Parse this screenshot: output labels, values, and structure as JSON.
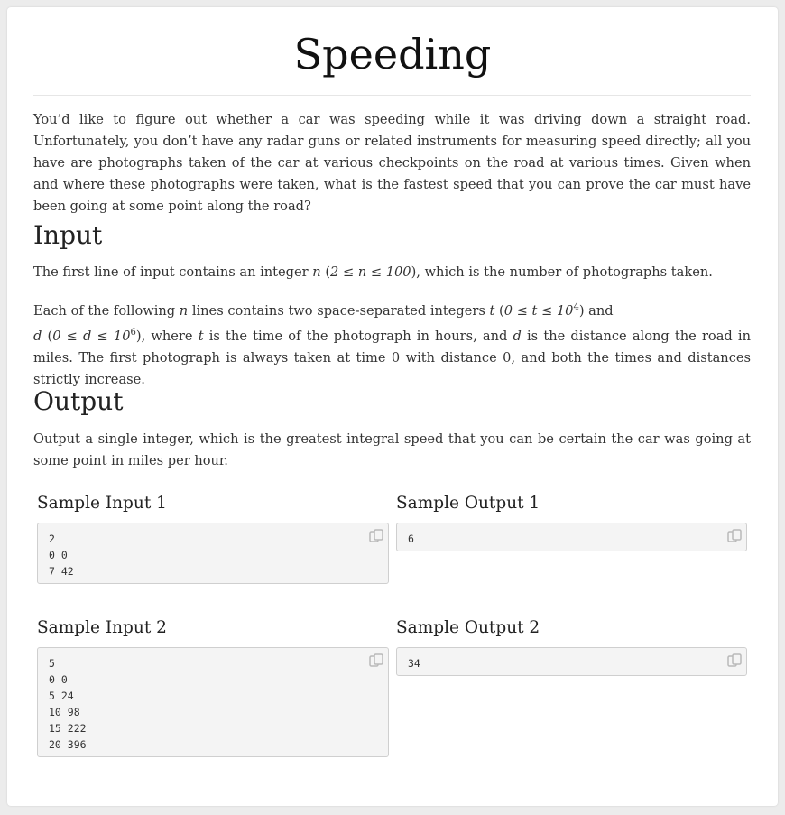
{
  "title": "Speeding",
  "intro": "You’d like to figure out whether a car was speeding while it was driving down a straight road. Unfortunately, you don’t have any radar guns or related instruments for measuring speed directly; all you have are photographs taken of the car at various checkpoints on the road at various times. Given when and where these photographs were taken, what is the fastest speed that you can prove the car must have been going at some point along the road?",
  "input": {
    "heading": "Input",
    "p1": {
      "a": "The first line of input contains an integer ",
      "var_n": "n",
      "b": " (",
      "math": "2 ≤ n ≤ 100",
      "c": "), which is the number of photographs taken."
    },
    "p2": {
      "a": "Each of the following ",
      "var_n": "n",
      "b": " lines contains two space-separated integers ",
      "var_t": "t",
      "c": " (",
      "math_t": "0 ≤ t ≤ 10",
      "exp_t": "4",
      "d": ") and",
      "var_d": "d",
      "e": " (",
      "math_d": "0 ≤ d ≤ 10",
      "exp_d": "6",
      "f": "), where ",
      "var_t2": "t",
      "g": " is the time of the photograph in hours, and ",
      "var_d2": "d",
      "h": " is the distance along the road in miles. The first photograph is always taken at time ",
      "zero1": "0",
      "i": " with distance ",
      "zero2": "0",
      "j": ", and both the times and distances strictly increase."
    }
  },
  "output": {
    "heading": "Output",
    "text": "Output a single integer, which is the greatest integral speed that you can be certain the car was going at some point in miles per hour."
  },
  "samples": [
    {
      "input_label": "Sample Input 1",
      "output_label": "Sample Output 1",
      "input": "2\n0 0\n7 42",
      "output": "6"
    },
    {
      "input_label": "Sample Input 2",
      "output_label": "Sample Output 2",
      "input": "5\n0 0\n5 24\n10 98\n15 222\n20 396",
      "output": "34"
    }
  ],
  "icons": {
    "copy": "copy-icon"
  }
}
